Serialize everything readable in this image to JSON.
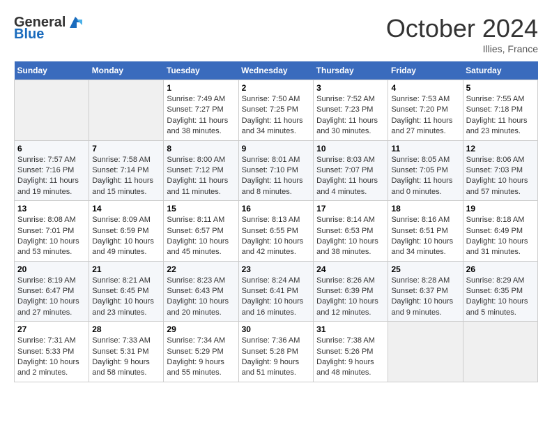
{
  "header": {
    "logo_general": "General",
    "logo_blue": "Blue",
    "month": "October 2024",
    "location": "Illies, France"
  },
  "weekdays": [
    "Sunday",
    "Monday",
    "Tuesday",
    "Wednesday",
    "Thursday",
    "Friday",
    "Saturday"
  ],
  "weeks": [
    [
      {
        "day": "",
        "empty": true
      },
      {
        "day": "",
        "empty": true
      },
      {
        "day": "1",
        "sunrise": "Sunrise: 7:49 AM",
        "sunset": "Sunset: 7:27 PM",
        "daylight": "Daylight: 11 hours and 38 minutes."
      },
      {
        "day": "2",
        "sunrise": "Sunrise: 7:50 AM",
        "sunset": "Sunset: 7:25 PM",
        "daylight": "Daylight: 11 hours and 34 minutes."
      },
      {
        "day": "3",
        "sunrise": "Sunrise: 7:52 AM",
        "sunset": "Sunset: 7:23 PM",
        "daylight": "Daylight: 11 hours and 30 minutes."
      },
      {
        "day": "4",
        "sunrise": "Sunrise: 7:53 AM",
        "sunset": "Sunset: 7:20 PM",
        "daylight": "Daylight: 11 hours and 27 minutes."
      },
      {
        "day": "5",
        "sunrise": "Sunrise: 7:55 AM",
        "sunset": "Sunset: 7:18 PM",
        "daylight": "Daylight: 11 hours and 23 minutes."
      }
    ],
    [
      {
        "day": "6",
        "sunrise": "Sunrise: 7:57 AM",
        "sunset": "Sunset: 7:16 PM",
        "daylight": "Daylight: 11 hours and 19 minutes."
      },
      {
        "day": "7",
        "sunrise": "Sunrise: 7:58 AM",
        "sunset": "Sunset: 7:14 PM",
        "daylight": "Daylight: 11 hours and 15 minutes."
      },
      {
        "day": "8",
        "sunrise": "Sunrise: 8:00 AM",
        "sunset": "Sunset: 7:12 PM",
        "daylight": "Daylight: 11 hours and 11 minutes."
      },
      {
        "day": "9",
        "sunrise": "Sunrise: 8:01 AM",
        "sunset": "Sunset: 7:10 PM",
        "daylight": "Daylight: 11 hours and 8 minutes."
      },
      {
        "day": "10",
        "sunrise": "Sunrise: 8:03 AM",
        "sunset": "Sunset: 7:07 PM",
        "daylight": "Daylight: 11 hours and 4 minutes."
      },
      {
        "day": "11",
        "sunrise": "Sunrise: 8:05 AM",
        "sunset": "Sunset: 7:05 PM",
        "daylight": "Daylight: 11 hours and 0 minutes."
      },
      {
        "day": "12",
        "sunrise": "Sunrise: 8:06 AM",
        "sunset": "Sunset: 7:03 PM",
        "daylight": "Daylight: 10 hours and 57 minutes."
      }
    ],
    [
      {
        "day": "13",
        "sunrise": "Sunrise: 8:08 AM",
        "sunset": "Sunset: 7:01 PM",
        "daylight": "Daylight: 10 hours and 53 minutes."
      },
      {
        "day": "14",
        "sunrise": "Sunrise: 8:09 AM",
        "sunset": "Sunset: 6:59 PM",
        "daylight": "Daylight: 10 hours and 49 minutes."
      },
      {
        "day": "15",
        "sunrise": "Sunrise: 8:11 AM",
        "sunset": "Sunset: 6:57 PM",
        "daylight": "Daylight: 10 hours and 45 minutes."
      },
      {
        "day": "16",
        "sunrise": "Sunrise: 8:13 AM",
        "sunset": "Sunset: 6:55 PM",
        "daylight": "Daylight: 10 hours and 42 minutes."
      },
      {
        "day": "17",
        "sunrise": "Sunrise: 8:14 AM",
        "sunset": "Sunset: 6:53 PM",
        "daylight": "Daylight: 10 hours and 38 minutes."
      },
      {
        "day": "18",
        "sunrise": "Sunrise: 8:16 AM",
        "sunset": "Sunset: 6:51 PM",
        "daylight": "Daylight: 10 hours and 34 minutes."
      },
      {
        "day": "19",
        "sunrise": "Sunrise: 8:18 AM",
        "sunset": "Sunset: 6:49 PM",
        "daylight": "Daylight: 10 hours and 31 minutes."
      }
    ],
    [
      {
        "day": "20",
        "sunrise": "Sunrise: 8:19 AM",
        "sunset": "Sunset: 6:47 PM",
        "daylight": "Daylight: 10 hours and 27 minutes."
      },
      {
        "day": "21",
        "sunrise": "Sunrise: 8:21 AM",
        "sunset": "Sunset: 6:45 PM",
        "daylight": "Daylight: 10 hours and 23 minutes."
      },
      {
        "day": "22",
        "sunrise": "Sunrise: 8:23 AM",
        "sunset": "Sunset: 6:43 PM",
        "daylight": "Daylight: 10 hours and 20 minutes."
      },
      {
        "day": "23",
        "sunrise": "Sunrise: 8:24 AM",
        "sunset": "Sunset: 6:41 PM",
        "daylight": "Daylight: 10 hours and 16 minutes."
      },
      {
        "day": "24",
        "sunrise": "Sunrise: 8:26 AM",
        "sunset": "Sunset: 6:39 PM",
        "daylight": "Daylight: 10 hours and 12 minutes."
      },
      {
        "day": "25",
        "sunrise": "Sunrise: 8:28 AM",
        "sunset": "Sunset: 6:37 PM",
        "daylight": "Daylight: 10 hours and 9 minutes."
      },
      {
        "day": "26",
        "sunrise": "Sunrise: 8:29 AM",
        "sunset": "Sunset: 6:35 PM",
        "daylight": "Daylight: 10 hours and 5 minutes."
      }
    ],
    [
      {
        "day": "27",
        "sunrise": "Sunrise: 7:31 AM",
        "sunset": "Sunset: 5:33 PM",
        "daylight": "Daylight: 10 hours and 2 minutes."
      },
      {
        "day": "28",
        "sunrise": "Sunrise: 7:33 AM",
        "sunset": "Sunset: 5:31 PM",
        "daylight": "Daylight: 9 hours and 58 minutes."
      },
      {
        "day": "29",
        "sunrise": "Sunrise: 7:34 AM",
        "sunset": "Sunset: 5:29 PM",
        "daylight": "Daylight: 9 hours and 55 minutes."
      },
      {
        "day": "30",
        "sunrise": "Sunrise: 7:36 AM",
        "sunset": "Sunset: 5:28 PM",
        "daylight": "Daylight: 9 hours and 51 minutes."
      },
      {
        "day": "31",
        "sunrise": "Sunrise: 7:38 AM",
        "sunset": "Sunset: 5:26 PM",
        "daylight": "Daylight: 9 hours and 48 minutes."
      },
      {
        "day": "",
        "empty": true
      },
      {
        "day": "",
        "empty": true
      }
    ]
  ]
}
